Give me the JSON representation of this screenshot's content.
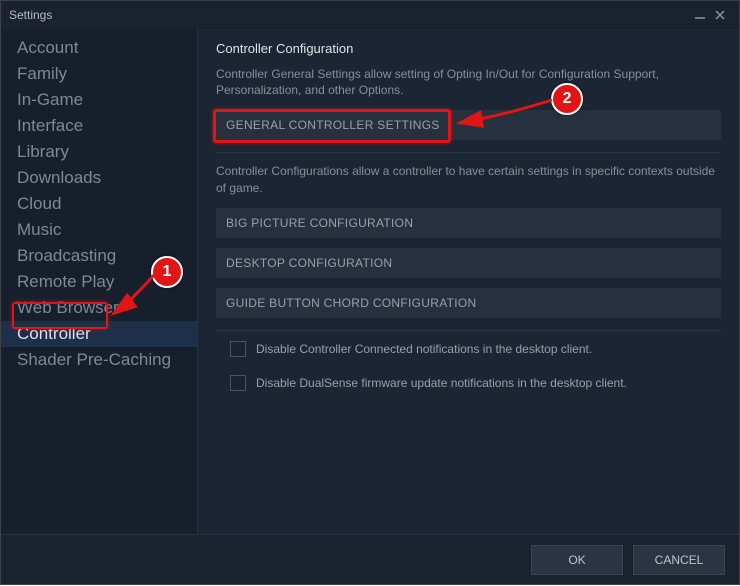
{
  "window": {
    "title": "Settings"
  },
  "sidebar": {
    "items": [
      {
        "label": "Account"
      },
      {
        "label": "Family"
      },
      {
        "label": "In-Game"
      },
      {
        "label": "Interface"
      },
      {
        "label": "Library"
      },
      {
        "label": "Downloads"
      },
      {
        "label": "Cloud"
      },
      {
        "label": "Music"
      },
      {
        "label": "Broadcasting"
      },
      {
        "label": "Remote Play"
      },
      {
        "label": "Web Browser"
      },
      {
        "label": "Controller"
      },
      {
        "label": "Shader Pre-Caching"
      }
    ],
    "active_index": 11
  },
  "main": {
    "heading": "Controller Configuration",
    "general_desc": "Controller General Settings allow setting of Opting In/Out for Configuration Support, Personalization, and other Options.",
    "general_button": "GENERAL CONTROLLER SETTINGS",
    "context_desc": "Controller Configurations allow a controller to have certain settings in specific contexts outside of game.",
    "buttons": [
      {
        "label": "BIG PICTURE CONFIGURATION"
      },
      {
        "label": "DESKTOP CONFIGURATION"
      },
      {
        "label": "GUIDE BUTTON CHORD CONFIGURATION"
      }
    ],
    "checkboxes": [
      {
        "label": "Disable Controller Connected notifications in the desktop client.",
        "checked": false
      },
      {
        "label": "Disable DualSense firmware update notifications in the desktop client.",
        "checked": false
      }
    ]
  },
  "footer": {
    "ok": "OK",
    "cancel": "CANCEL"
  },
  "annotations": {
    "badge1": "1",
    "badge2": "2"
  }
}
